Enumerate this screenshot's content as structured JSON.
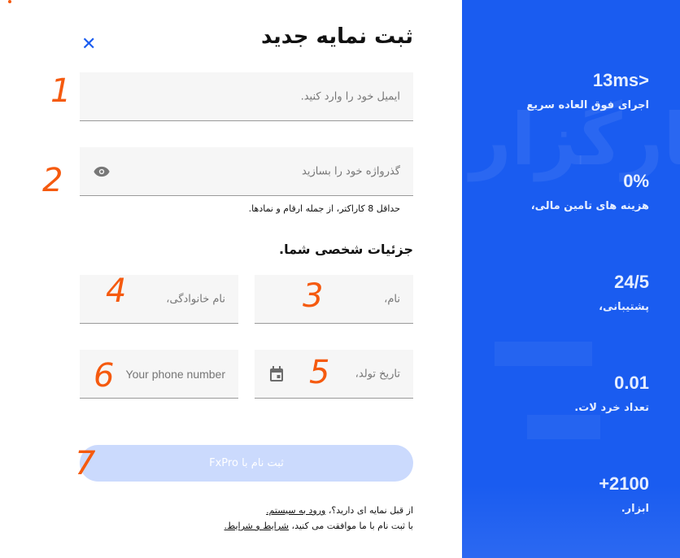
{
  "form": {
    "title": "ثبت نمایه جدید",
    "email_placeholder": "ایمیل خود را وارد کنید.",
    "password_placeholder": "گذرواژه خود را بسازید",
    "password_hint": "حداقل 8 کاراکتر، از جمله ارقام و نمادها.",
    "section_title": "جزئیات شخصی شما.",
    "first_name_placeholder": "نام،",
    "last_name_placeholder": "نام خانوادگی،",
    "birthdate_placeholder": "تاریخ تولد،",
    "phone_placeholder": "Your phone number",
    "submit_label": "ثبت نام با FxPro",
    "footer_line1": "از قبل نمایه ای دارید؟،",
    "login_link": "ورود به سیستم.",
    "footer_line2": "با ثبت نام با ما موافقت می کنید،",
    "terms_link": "شرایط و شرایط."
  },
  "stats": [
    {
      "value": "13ms>",
      "label": "اجرای فوق العاده سریع"
    },
    {
      "value": "0%",
      "label": "هزینه های تامین مالی،"
    },
    {
      "value": "24/5",
      "label": "پشتیبانی،"
    },
    {
      "value": "0.01",
      "label": "تعداد خرد لات."
    },
    {
      "value": "+2100",
      "label": "ابزار."
    }
  ],
  "annotations": [
    "1",
    "2",
    "3",
    "4",
    "5",
    "6",
    "7"
  ],
  "watermark": "کارگزار",
  "colors": {
    "accent": "#1a5cf0",
    "annotation": "#f55a0f",
    "submit_disabled": "#cbdafd"
  }
}
